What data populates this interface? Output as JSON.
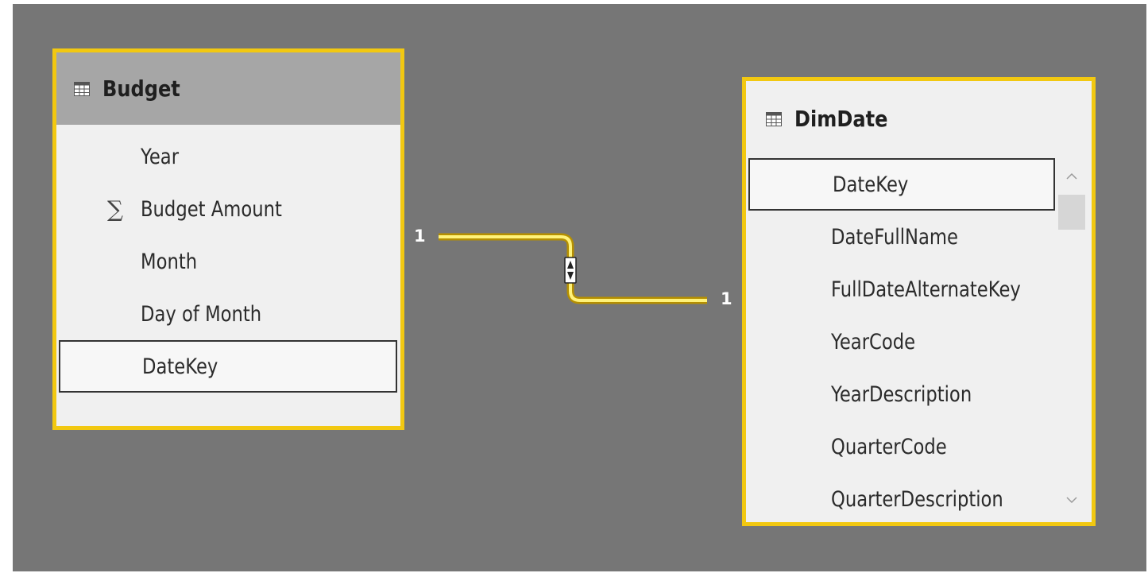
{
  "budget_table": {
    "title": "Budget",
    "icon": "table-icon",
    "fields": [
      {
        "label": "Year"
      },
      {
        "label": "Budget Amount",
        "icon": "sigma-icon"
      },
      {
        "label": "Month"
      },
      {
        "label": "Day of Month"
      },
      {
        "label": "DateKey",
        "selected": true
      }
    ]
  },
  "dimdate_table": {
    "title": "DimDate",
    "icon": "table-icon",
    "fields": [
      {
        "label": "DateKey",
        "selected": true
      },
      {
        "label": "DateFullName"
      },
      {
        "label": "FullDateAlternateKey"
      },
      {
        "label": "YearCode"
      },
      {
        "label": "YearDescription"
      },
      {
        "label": "QuarterCode"
      },
      {
        "label": "QuarterDescription"
      }
    ]
  },
  "relationship": {
    "from_cardinality": "1",
    "to_cardinality": "1",
    "cross_filter": "both-directions-icon"
  },
  "colors": {
    "canvas": "#767676",
    "highlight": "#f2c811",
    "card": "#f0f0f0",
    "header_selected": "#a6a6a6"
  }
}
